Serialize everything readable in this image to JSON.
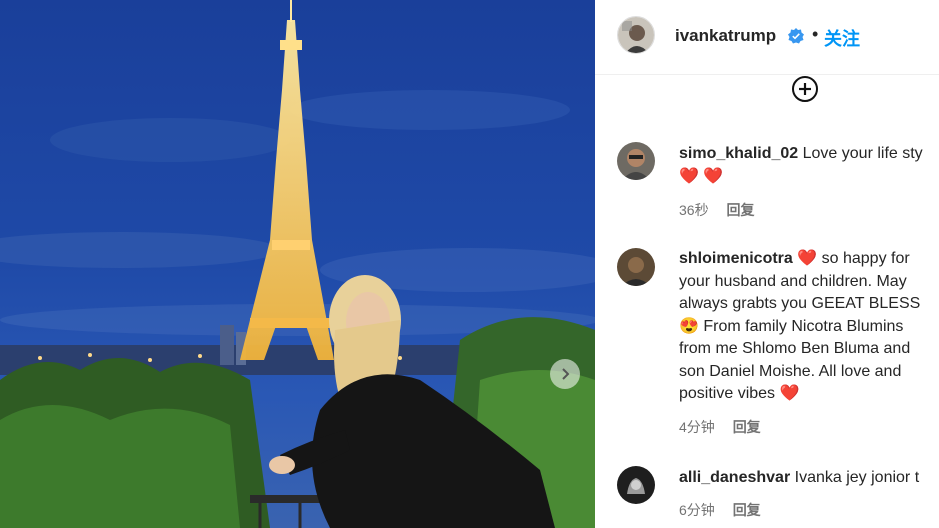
{
  "post": {
    "username": "ivankatrump",
    "follow_label": "关注",
    "separator": "•"
  },
  "comments": [
    {
      "username": "simo_khalid_02",
      "lines": [
        "Love your life sty",
        "❤️ ❤️"
      ],
      "time": "36秒",
      "reply_label": "回复"
    },
    {
      "username": "shloimenicotra",
      "lines": [
        "❤️ so happy for",
        "your husband and children. May",
        "always grabts you GEEAT BLESS",
        "😍 From family Nicotra Blumins",
        "from me Shlomo Ben Bluma and",
        "son Daniel Moishe. All love and",
        "positive vibes ❤️"
      ],
      "time": "4分钟",
      "reply_label": "回复"
    },
    {
      "username": "alli_daneshvar",
      "lines": [
        "Ivanka jey jonior t"
      ],
      "time": "6分钟",
      "reply_label": "回复"
    }
  ],
  "colors": {
    "link_blue": "#0095f6",
    "verified": "#3897f0",
    "heart": "#ed4956",
    "meta_gray": "#737373"
  },
  "icons": [
    "verified-badge-icon",
    "plus-circle-icon",
    "chevron-right-icon"
  ]
}
